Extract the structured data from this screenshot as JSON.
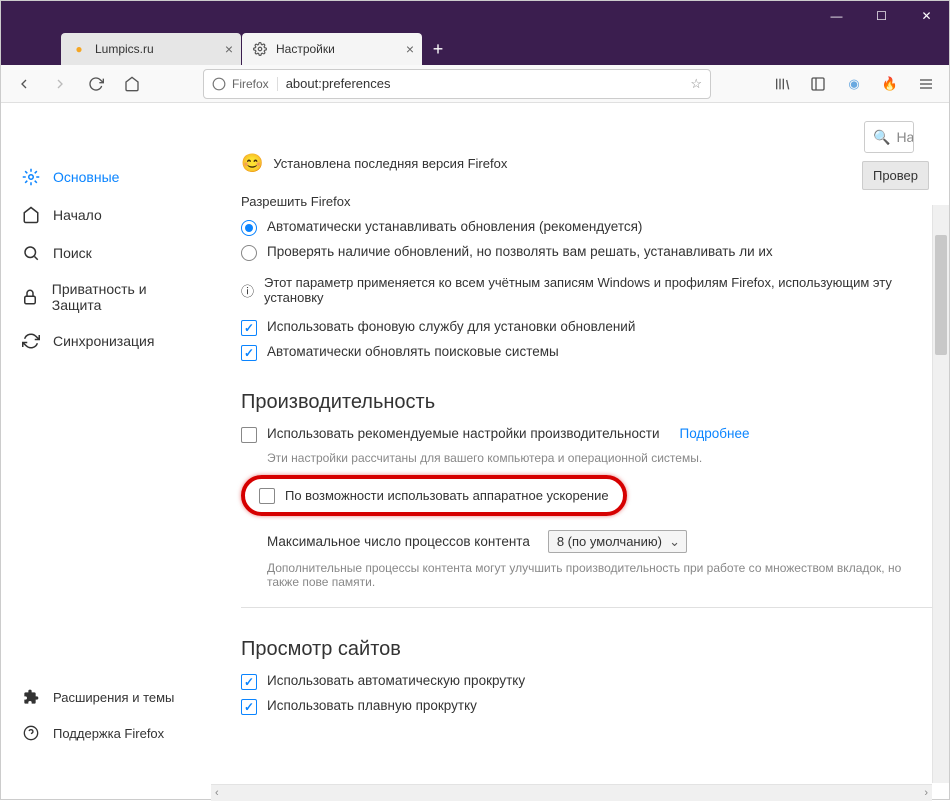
{
  "window": {
    "min": "—",
    "max": "☐",
    "close": "✕"
  },
  "tabs": {
    "tab1": "Lumpics.ru",
    "tab2": "Настройки",
    "newtab": "+"
  },
  "urlbar": {
    "identity": "Firefox",
    "url": "about:preferences"
  },
  "sidebar": {
    "general": "Основные",
    "home": "Начало",
    "search": "Поиск",
    "privacy": "Приватность и Защита",
    "sync": "Синхронизация",
    "extensions": "Расширения и темы",
    "support": "Поддержка Firefox"
  },
  "searchbox": {
    "placeholder": "Най"
  },
  "updates": {
    "status": "Установлена последняя версия Firefox",
    "check_btn": "Провер",
    "allow_label": "Разрешить Firefox",
    "auto": "Автоматически устанавливать обновления (рекомендуется)",
    "manual": "Проверять наличие обновлений, но позволять вам решать, устанавливать ли их",
    "info": "Этот параметр применяется ко всем учётным записям Windows и профилям Firefox, использующим эту установку",
    "bg_service": "Использовать фоновую службу для установки обновлений",
    "auto_search": "Автоматически обновлять поисковые системы"
  },
  "performance": {
    "heading": "Производительность",
    "recommended": "Использовать рекомендуемые настройки производительности",
    "more": "Подробнее",
    "sub1": "Эти настройки рассчитаны для вашего компьютера и операционной системы.",
    "hw_accel": "По возможности использовать аппаратное ускорение",
    "max_proc_label": "Максимальное число процессов контента",
    "max_proc_value": "8 (по умолчанию)",
    "sub2": "Дополнительные процессы контента могут улучшить производительность при работе со множеством вкладок, но также пове памяти."
  },
  "browsing": {
    "heading": "Просмотр сайтов",
    "auto_scroll": "Использовать автоматическую прокрутку",
    "smooth_scroll": "Использовать плавную прокрутку"
  }
}
